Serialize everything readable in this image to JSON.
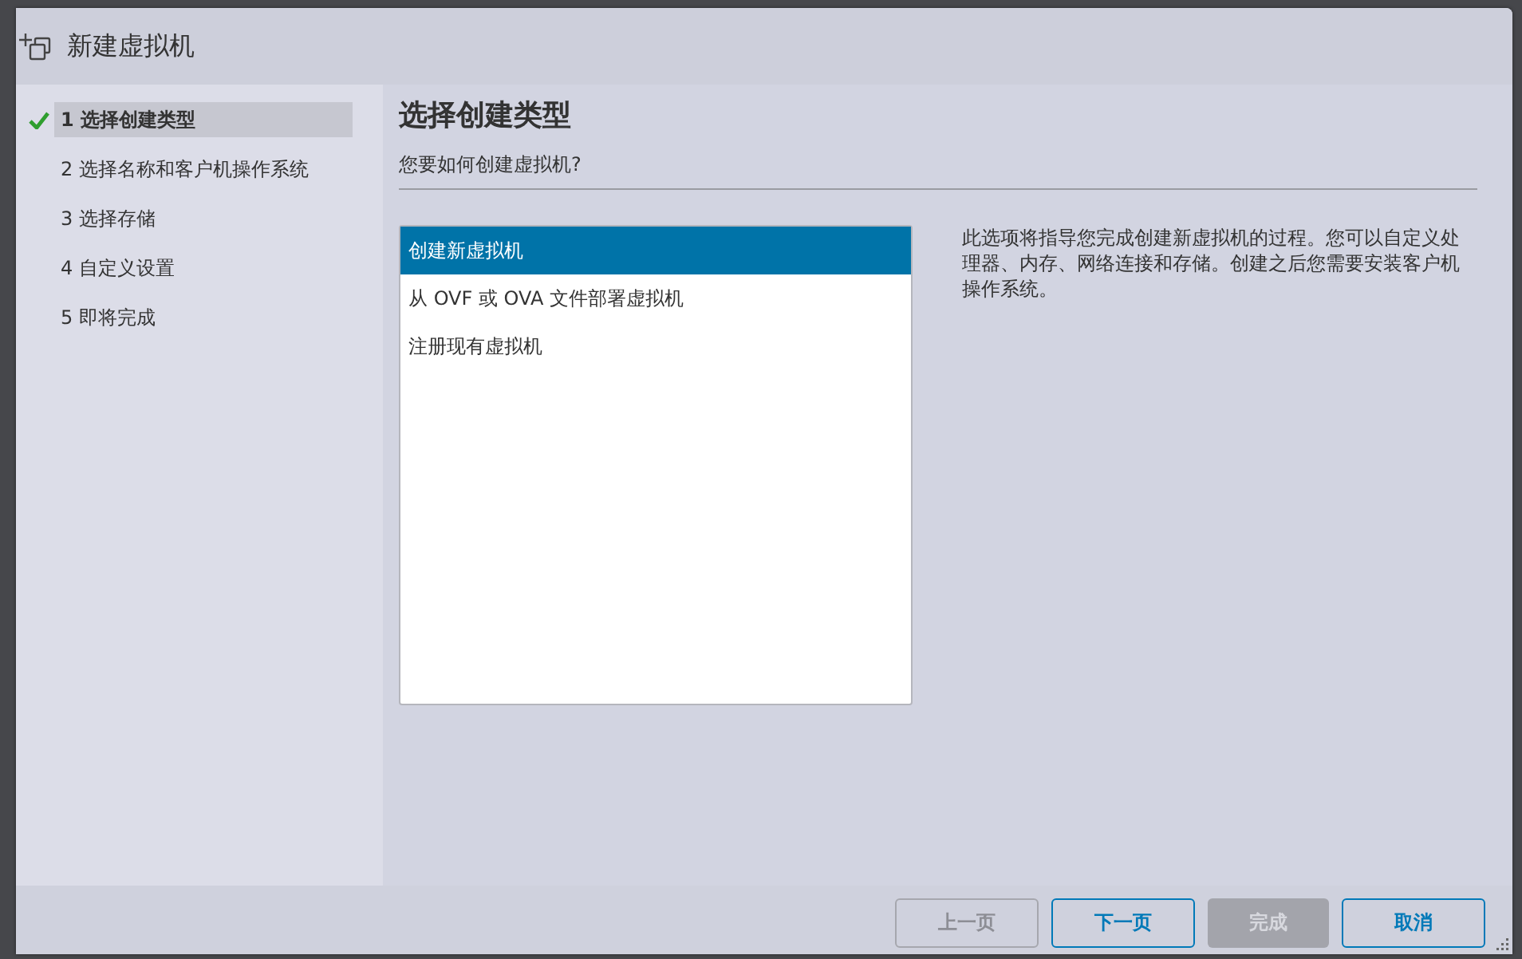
{
  "window": {
    "title": "新建虚拟机"
  },
  "steps": [
    {
      "label": "1 选择创建类型",
      "selected": true,
      "completed": true
    },
    {
      "label": "2 选择名称和客户机操作系统",
      "selected": false,
      "completed": false
    },
    {
      "label": "3 选择存储",
      "selected": false,
      "completed": false
    },
    {
      "label": "4 自定义设置",
      "selected": false,
      "completed": false
    },
    {
      "label": "5 即将完成",
      "selected": false,
      "completed": false
    }
  ],
  "page": {
    "title": "选择创建类型",
    "subtitle": "您要如何创建虚拟机?"
  },
  "options": [
    {
      "label": "创建新虚拟机",
      "selected": true
    },
    {
      "label": "从 OVF 或 OVA 文件部署虚拟机",
      "selected": false
    },
    {
      "label": "注册现有虚拟机",
      "selected": false
    }
  ],
  "description": "此选项将指导您完成创建新虚拟机的过程。您可以自定义处理器、内存、网络连接和存储。创建之后您需要安装客户机操作系统。",
  "buttons": [
    {
      "label": "上一页",
      "kind": "outline",
      "disabled": true
    },
    {
      "label": "下一页",
      "kind": "outline",
      "disabled": false
    },
    {
      "label": "完成",
      "kind": "filled",
      "disabled": true
    },
    {
      "label": "取消",
      "kind": "outline",
      "disabled": false
    }
  ]
}
